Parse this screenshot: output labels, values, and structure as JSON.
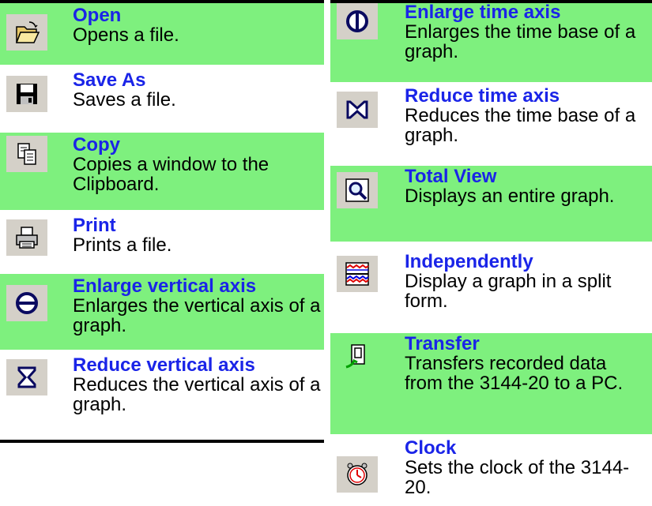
{
  "left": {
    "items": [
      {
        "title": "Open",
        "desc": "Opens a file."
      },
      {
        "title": "Save As",
        "desc": "Saves a file."
      },
      {
        "title": "Copy",
        "desc": "Copies a window to the Clipboard."
      },
      {
        "title": "Print",
        "desc": "Prints a file."
      },
      {
        "title": "Enlarge vertical axis",
        "desc": "Enlarges the vertical axis of a graph."
      },
      {
        "title": "Reduce vertical axis",
        "desc": "Reduces the vertical axis of a graph."
      }
    ]
  },
  "right": {
    "items": [
      {
        "title": "Enlarge time axis",
        "desc": "Enlarges the time base of a graph."
      },
      {
        "title": "Reduce time axis",
        "desc": "Reduces the time base of a graph."
      },
      {
        "title": "Total View",
        "desc": "Displays an entire graph."
      },
      {
        "title": "Independently",
        "desc": "Display a graph in a split form."
      },
      {
        "title": "Transfer",
        "desc": "Transfers recorded data from the 3144-20 to a PC."
      },
      {
        "title": "Clock",
        "desc": "Sets the clock of the 3144-20."
      }
    ]
  },
  "colors": {
    "green": "#7ef07e",
    "title": "#1a24e8",
    "iconbg": "#d4d0c8"
  },
  "icons": [
    "open-folder-icon",
    "save-disk-icon",
    "copy-icon",
    "printer-icon",
    "enlarge-vertical-icon",
    "reduce-vertical-icon",
    "enlarge-time-icon",
    "reduce-time-icon",
    "total-view-icon",
    "independently-icon",
    "transfer-icon",
    "clock-icon"
  ]
}
